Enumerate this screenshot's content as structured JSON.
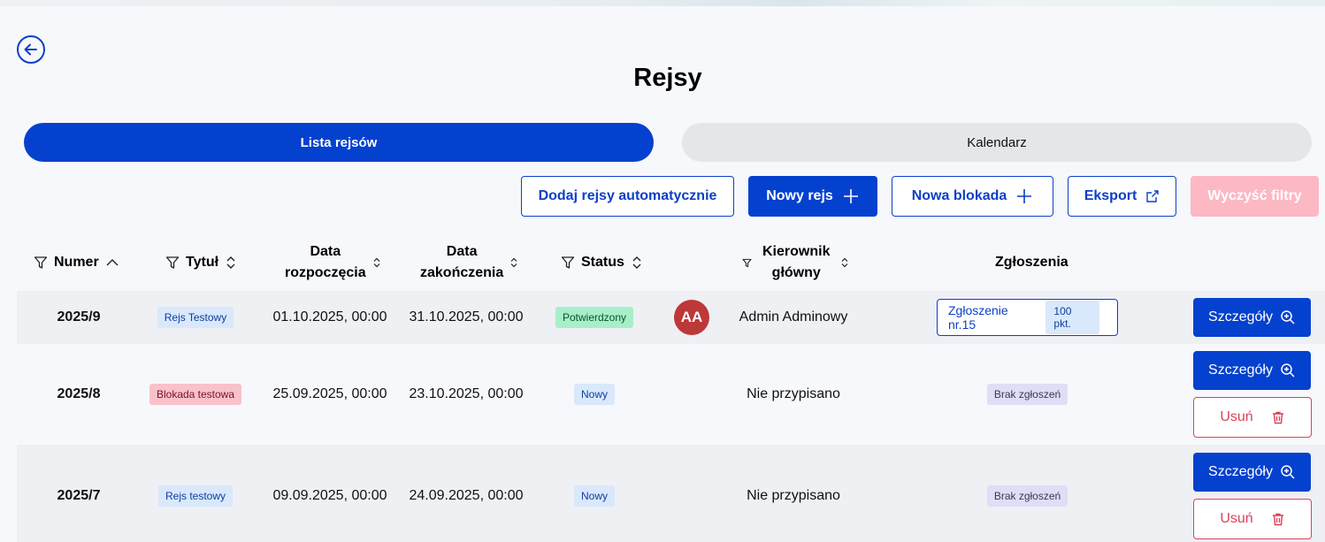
{
  "page": {
    "title": "Rejsy"
  },
  "tabs": {
    "list": "Lista rejsów",
    "calendar": "Kalendarz"
  },
  "actions": {
    "auto_add": "Dodaj rejsy automatycznie",
    "new_cruise": "Nowy rejs",
    "new_block": "Nowa blokada",
    "export": "Eksport",
    "clear_filters": "Wyczyść filtry"
  },
  "columns": {
    "number": "Numer",
    "title": "Tytuł",
    "start_1": "Data",
    "start_2": "rozpoczęcia",
    "end_1": "Data",
    "end_2": "zakończenia",
    "status": "Status",
    "manager_1": "Kierownik",
    "manager_2": "główny",
    "applications": "Zgłoszenia"
  },
  "rows": [
    {
      "number": "2025/9",
      "title": "Rejs Testowy",
      "start": "01.10.2025, 00:00",
      "end": "31.10.2025, 00:00",
      "status": "Potwierdzony",
      "avatar": "AA",
      "manager": "Admin Adminowy",
      "application": "Zgłoszenie nr.15",
      "points": "100 pkt.",
      "details": "Szczegóły"
    },
    {
      "number": "2025/8",
      "title": "Blokada testowa",
      "start": "25.09.2025, 00:00",
      "end": "23.10.2025, 00:00",
      "status": "Nowy",
      "manager": "Nie przypisano",
      "application": "Brak zgłoszeń",
      "details": "Szczegóły",
      "delete": "Usuń"
    },
    {
      "number": "2025/7",
      "title": "Rejs testowy",
      "start": "09.09.2025, 00:00",
      "end": "24.09.2025, 00:00",
      "status": "Nowy",
      "manager": "Nie przypisano",
      "application": "Brak zgłoszeń",
      "details": "Szczegóły",
      "delete": "Usuń"
    }
  ],
  "icons": {
    "back": "arrow-left-circle-icon",
    "filter": "filter-icon",
    "sort": "sort-icon",
    "plus": "plus-icon",
    "external": "external-link-icon",
    "zoom": "zoom-in-icon",
    "trash": "trash-icon"
  },
  "colors": {
    "primary": "#0541cf",
    "danger": "#d9435a",
    "avatar": "#bd3838"
  }
}
